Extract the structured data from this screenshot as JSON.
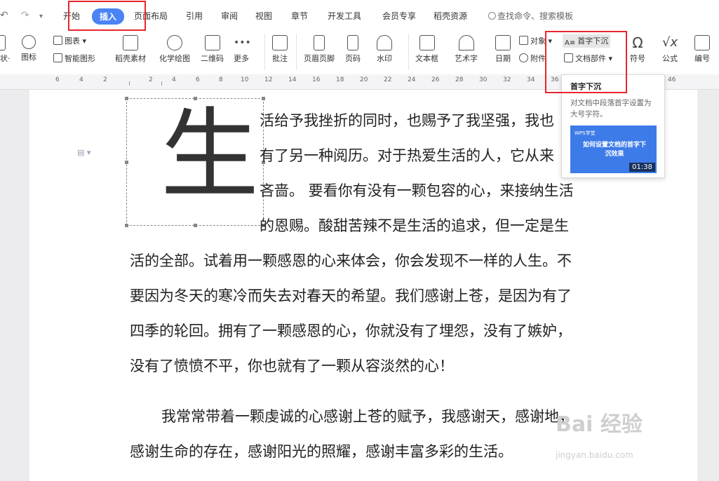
{
  "toolbar": {
    "undo_glyph": "↶",
    "redo_glyph": "↷",
    "more_glyph": "▾"
  },
  "tabs": [
    {
      "label": "开始"
    },
    {
      "label": "插入"
    },
    {
      "label": "页面布局"
    },
    {
      "label": "引用"
    },
    {
      "label": "审阅"
    },
    {
      "label": "视图"
    },
    {
      "label": "章节"
    },
    {
      "label": "开发工具"
    },
    {
      "label": "会员专享"
    },
    {
      "label": "稻壳资源"
    }
  ],
  "search": {
    "placeholder": "查找命令、搜索模板"
  },
  "ribbon": {
    "shape_partial": "状·",
    "icons_label": "图标",
    "chart_label": "图表",
    "smart_art_label": "智能图形",
    "docer_label": "稻壳素材",
    "chem_label": "化学绘图",
    "qrcode_label": "二维码",
    "more_label": "更多",
    "comment_label": "批注",
    "header_footer_label": "页眉页脚",
    "page_num_label": "页码",
    "watermark_label": "水印",
    "textbox_label": "文本框",
    "wordart_label": "艺术字",
    "date_label": "日期",
    "object_label": "对象",
    "attachment_label": "附件",
    "dropcap_label": "首字下沉",
    "docparts_label": "文档部件",
    "symbol_label": "符号",
    "formula_label": "公式",
    "number_label": "编号"
  },
  "ruler": {
    "ticks": [
      "6",
      "4",
      "2",
      "2",
      "4",
      "6",
      "8",
      "10",
      "12",
      "14",
      "16",
      "18",
      "20",
      "22",
      "24",
      "26",
      "28",
      "30",
      "32",
      "34",
      "36",
      "46"
    ]
  },
  "tooltip": {
    "title": "首字下沉",
    "description": "对文档中段落首字设置为大号字符。",
    "video_title": "如何设置文档的首字下沉效果",
    "video_duration": "01:38",
    "video_logo": "WPS学堂"
  },
  "document": {
    "dropcap_char": "生",
    "para_icon": "▤ ▾",
    "lines": [
      "活给予我挫折的同时，也赐予了我坚强，我也",
      "有了另一种阅历。对于热爱生活的人，它从来",
      "吝啬。  要看你有没有一颗包容的心，来接纳生活",
      "的恩赐。酸甜苦辣不是生活的追求，但一定是生",
      "活的全部。试着用一颗感恩的心来体会，你会发现不一样的人生。不",
      "要因为冬天的寒冷而失去对春天的希望。我们感谢上苍，是因为有了",
      "四季的轮回。拥有了一颗感恩的心，你就没有了埋怨，没有了嫉妒，",
      "没有了愤愤不平，你也就有了一颗从容淡然的心！",
      "我常常带着一颗虔诚的心感谢上苍的赋予，我感谢天，感谢地，",
      "感谢生命的存在，感谢阳光的照耀，感谢丰富多彩的生活。"
    ]
  },
  "watermark": {
    "text": "Bai 经验",
    "sub": "jingyan.baidu.com"
  },
  "colors": {
    "accent": "#4a83f5",
    "annotation": "#e8262d"
  }
}
